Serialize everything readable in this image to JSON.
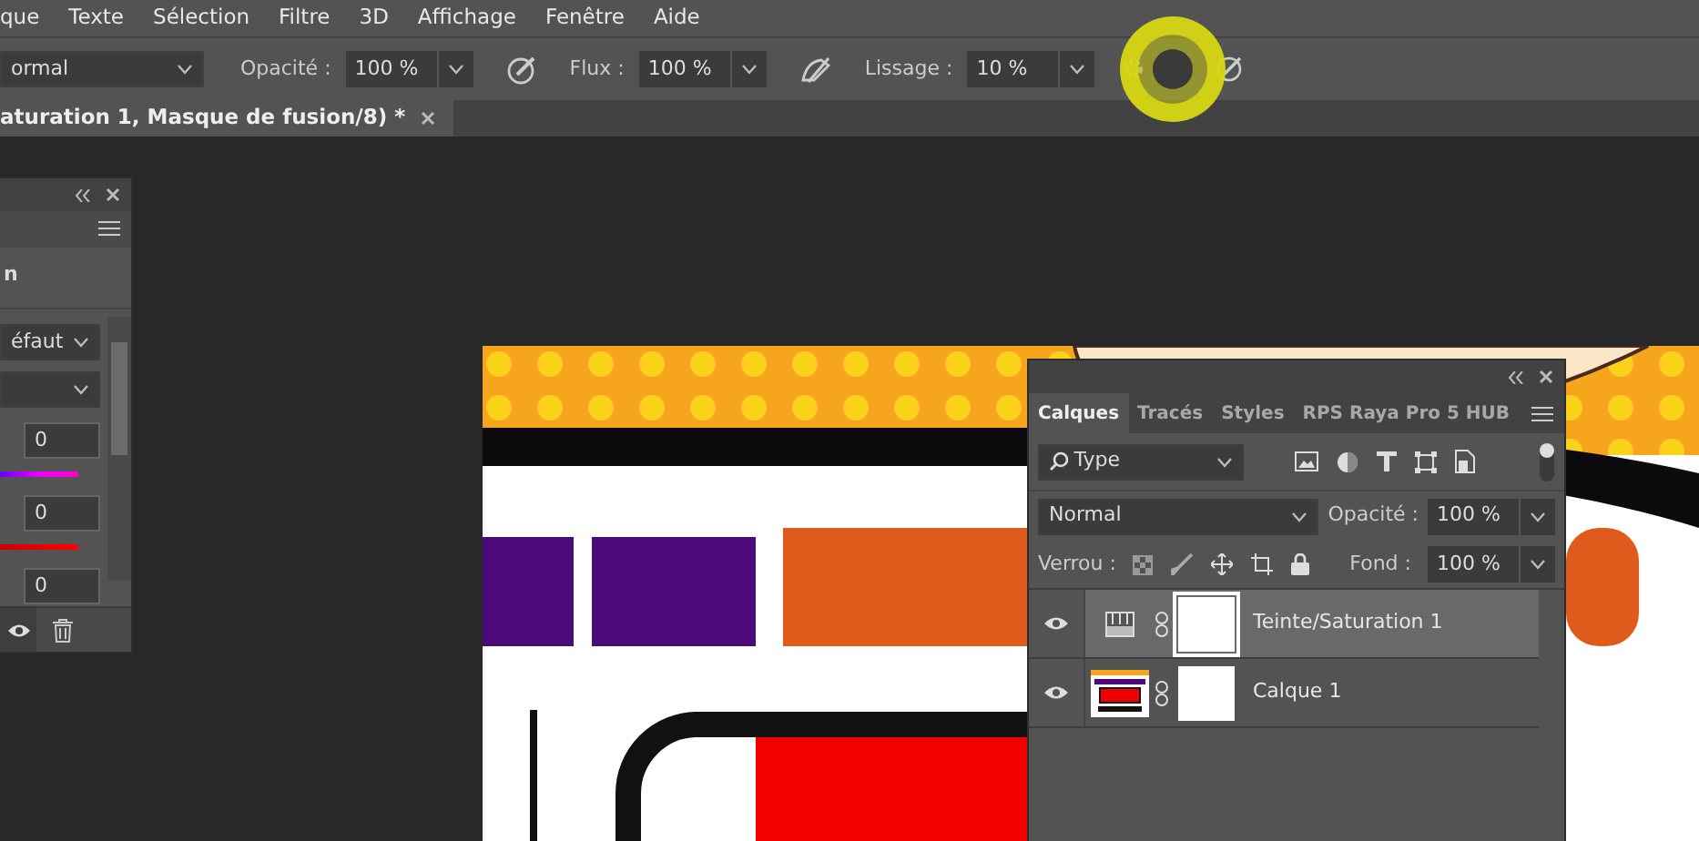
{
  "menu": [
    "que",
    "Texte",
    "Sélection",
    "Filtre",
    "3D",
    "Affichage",
    "Fenêtre",
    "Aide"
  ],
  "options": {
    "blend_mode": "ormal",
    "opacity_label": "Opacité :",
    "opacity": "100 %",
    "flow_label": "Flux :",
    "flow": "100 %",
    "smoothing_label": "Lissage :",
    "smoothing": "10 %"
  },
  "document_tab": {
    "title": "aturation 1, Masque de fusion/8) *"
  },
  "properties_panel": {
    "heading": "n",
    "preset": "éfaut",
    "fields": [
      {
        "value": "0",
        "kind": "hue"
      },
      {
        "value": "0",
        "kind": "saturation"
      },
      {
        "value": "0",
        "kind": "lightness"
      }
    ]
  },
  "layers_panel": {
    "tabs": [
      {
        "label": "Calques",
        "selected": true
      },
      {
        "label": "Tracés",
        "selected": false
      },
      {
        "label": "Styles",
        "selected": false
      },
      {
        "label": "RPS Raya Pro 5 HUB",
        "selected": false
      }
    ],
    "filter": "Type",
    "blend_mode": "Normal",
    "opacity_label": "Opacité :",
    "opacity": "100 %",
    "lock_label": "Verrou :",
    "fill_label": "Fond :",
    "fill": "100 %",
    "layers": [
      {
        "name": "Teinte/Saturation 1",
        "kind": "adjustment",
        "visible": true,
        "selected": true
      },
      {
        "name": "Calque 1",
        "kind": "image",
        "visible": true,
        "selected": false
      }
    ]
  }
}
